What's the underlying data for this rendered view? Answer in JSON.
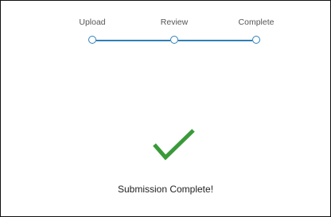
{
  "stepper": {
    "steps": [
      {
        "label": "Upload",
        "state": "complete"
      },
      {
        "label": "Review",
        "state": "complete"
      },
      {
        "label": "Complete",
        "state": "complete"
      }
    ],
    "color": "#2f7fb8"
  },
  "result": {
    "icon": "checkmark-icon",
    "icon_color": "#3a9a3a",
    "message": "Submission Complete!"
  }
}
